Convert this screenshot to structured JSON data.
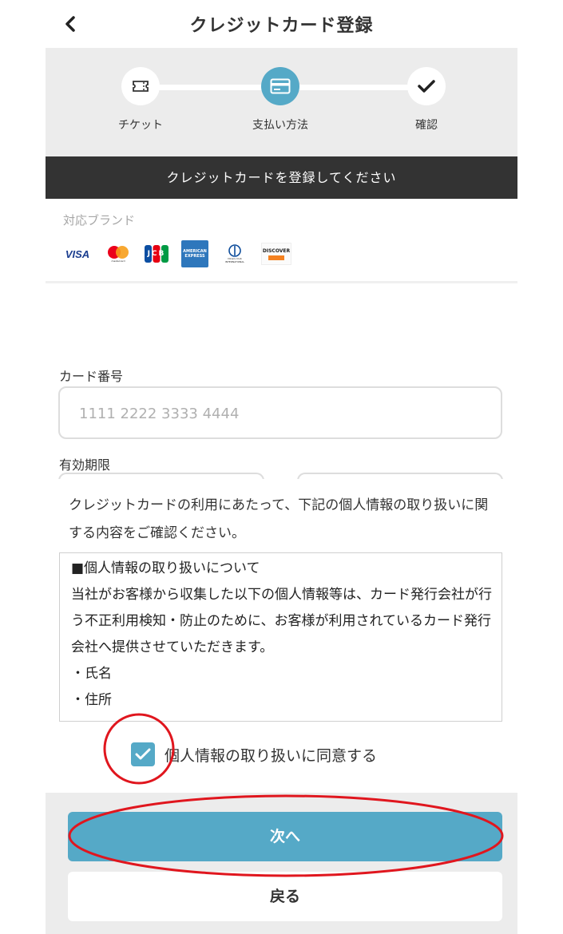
{
  "header": {
    "title": "クレジットカード登録",
    "back_icon": "chevron-left-icon"
  },
  "stepper": {
    "steps": [
      {
        "label": "チケット",
        "icon": "ticket-icon"
      },
      {
        "label": "支払い方法",
        "icon": "credit-card-icon",
        "active": true
      },
      {
        "label": "確認",
        "icon": "check-icon"
      }
    ]
  },
  "banner": {
    "text": "クレジットカードを登録してください"
  },
  "brands": {
    "label": "対応ブランド",
    "items": [
      {
        "name": "VISA",
        "text": "VISA"
      },
      {
        "name": "Mastercard",
        "text": "mastercard"
      },
      {
        "name": "JCB",
        "text": "JCB"
      },
      {
        "name": "American Express",
        "text": "AMERICAN EXPRESS"
      },
      {
        "name": "Diners Club",
        "text": "Diners Club INTERNATIONAL"
      },
      {
        "name": "Discover",
        "text": "DISCOVER"
      }
    ]
  },
  "form": {
    "card_number_label": "カード番号",
    "card_number_placeholder": "1111 2222 3333 4444",
    "expiry_label": "有効期限"
  },
  "consent": {
    "intro": "クレジットカードの利用にあたって、下記の個人情報の取り扱いに関する内容をご確認ください。",
    "policy_title": "■個人情報の取り扱いについて",
    "policy_body": "当社がお客様から収集した以下の個人情報等は、カード発行会社が行う不正利用検知・防止のために、お客様が利用されているカード発行会社へ提供させていただきます。",
    "policy_items": [
      "・氏名",
      "・住所"
    ],
    "agree_label": "個人情報の取り扱いに同意する",
    "agree_checked": true
  },
  "buttons": {
    "next_label": "次へ",
    "back_label": "戻る"
  },
  "colors": {
    "accent": "#55a9c7",
    "banner_bg": "#333333",
    "panel_bg": "#ececec",
    "annotation": "#e0161e"
  }
}
